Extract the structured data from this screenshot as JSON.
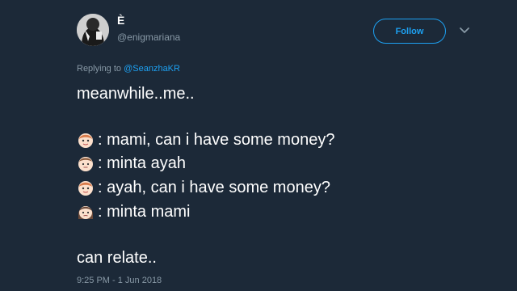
{
  "user": {
    "display_name": "È",
    "handle": "@enigmariana",
    "follow_label": "Follow"
  },
  "reply": {
    "prefix": "Replying to ",
    "mention": "@SeanzhaKR"
  },
  "tweet": {
    "intro": "meanwhile..me..",
    "dialogue": [
      {
        "speaker_icon": "child-face-icon",
        "text": ": mami, can i have some money?"
      },
      {
        "speaker_icon": "man-face-icon",
        "text": ": minta ayah"
      },
      {
        "speaker_icon": "child-face-icon",
        "text": ": ayah, can i have some money?"
      },
      {
        "speaker_icon": "woman-face-icon",
        "text": ": minta mami"
      }
    ],
    "closing": "can relate.."
  },
  "timestamp": "9:25 PM - 1 Jun 2018",
  "colors": {
    "background": "#1c2938",
    "accent": "#1da1f2",
    "muted": "#8899a6"
  }
}
